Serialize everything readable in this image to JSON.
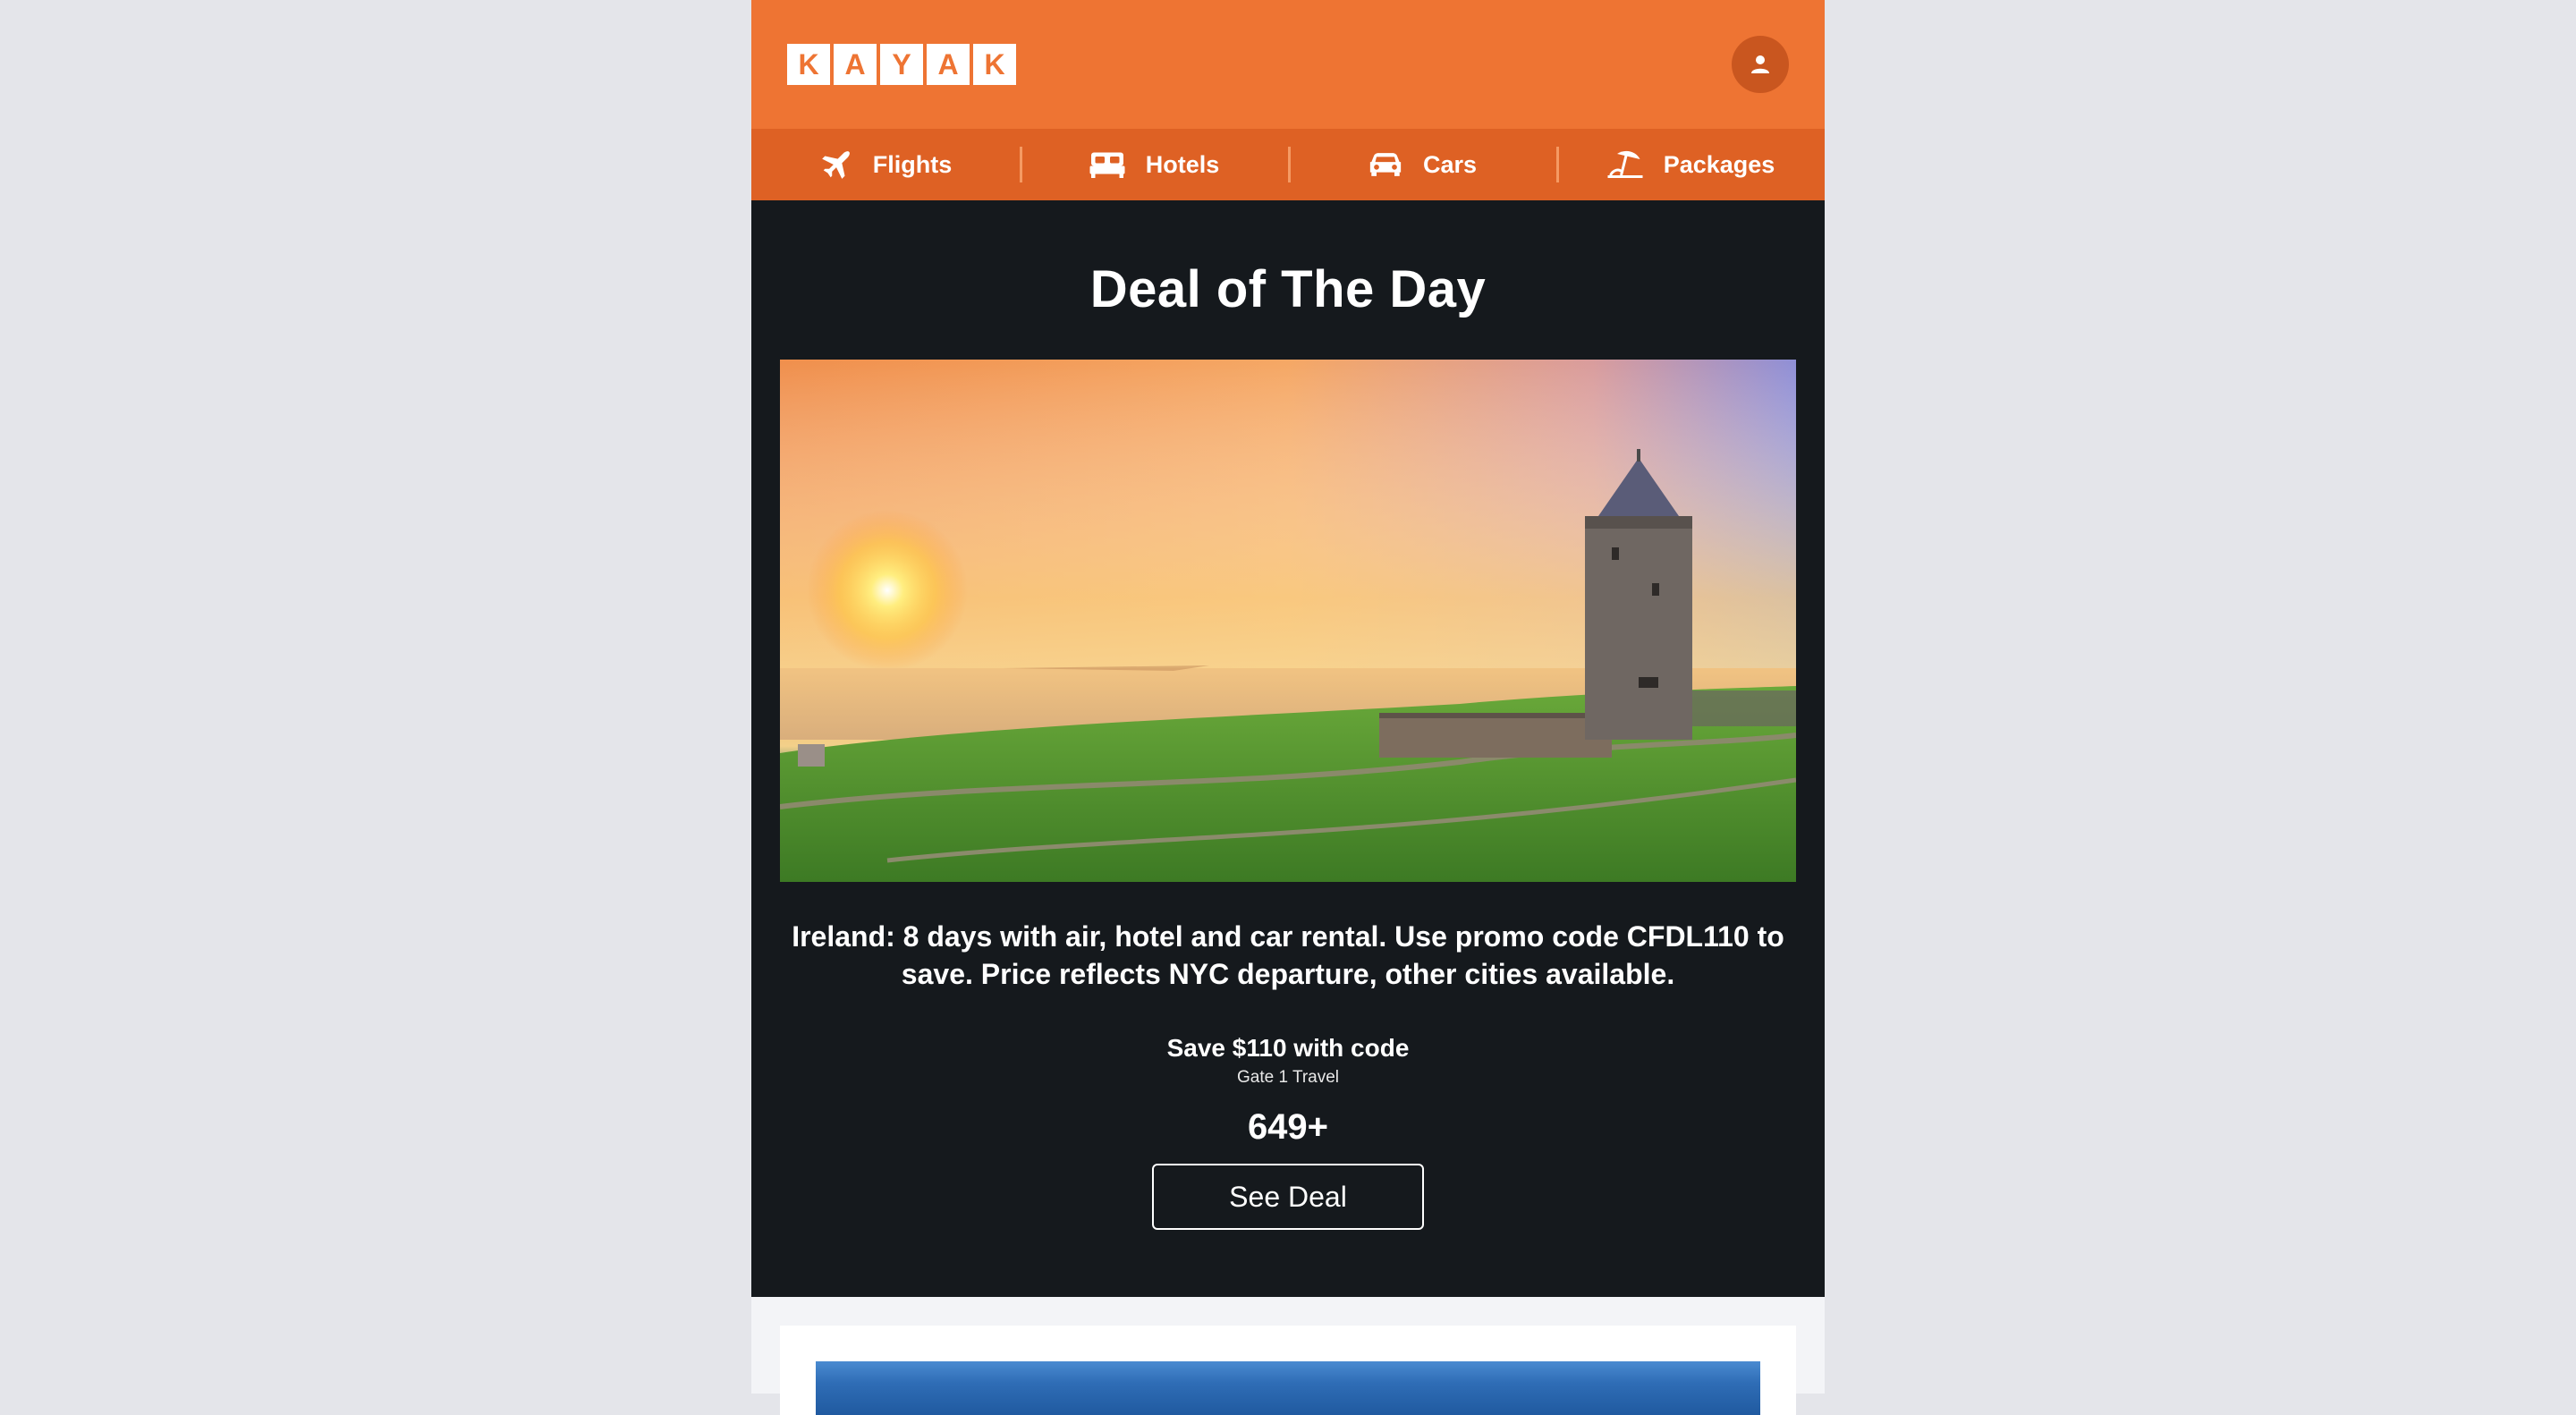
{
  "header": {
    "logo_letters": [
      "K",
      "A",
      "Y",
      "A",
      "K"
    ],
    "brand_color": "#ee7433",
    "account_icon": "user-icon"
  },
  "nav": {
    "items": [
      {
        "label": "Flights",
        "icon": "airplane-icon"
      },
      {
        "label": "Hotels",
        "icon": "bed-icon"
      },
      {
        "label": "Cars",
        "icon": "car-icon"
      },
      {
        "label": "Packages",
        "icon": "beach-umbrella-icon"
      }
    ]
  },
  "deal": {
    "title": "Deal of The Day",
    "image_alt": "castle-tower-sunset-coast",
    "description": "Ireland: 8 days with air, hotel and car rental. Use promo code CFDL110 to save. Price reflects NYC departure, other cities available.",
    "save_label": "Save $110 with code",
    "provider": "Gate 1 Travel",
    "price": "649+",
    "cta_label": "See Deal"
  }
}
